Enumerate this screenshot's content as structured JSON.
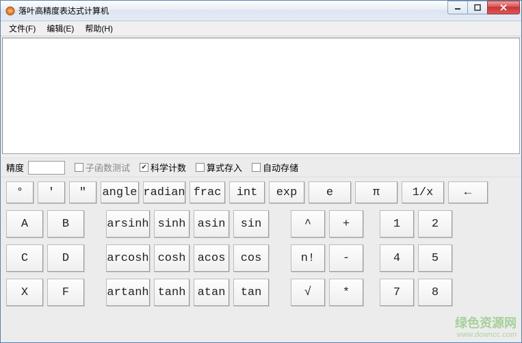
{
  "window": {
    "title": "落叶高精度表达式计算机"
  },
  "menu": {
    "file": "文件(F)",
    "edit": "编辑(E)",
    "help": "帮助(H)"
  },
  "textarea": {
    "value": ""
  },
  "options": {
    "precision_label": "精度",
    "precision_value": "",
    "subfn_test": "子函数测试",
    "sci_notation": "科学计数",
    "save_expr": "算式存入",
    "auto_save": "自动存储"
  },
  "row_top": {
    "deg": "°",
    "min": "′",
    "sec": "″",
    "angle": "angle",
    "radian": "radian",
    "frac": "frac",
    "int": "int",
    "exp": "exp",
    "e": "e",
    "pi": "π",
    "inv": "1/x",
    "back": "←"
  },
  "rows": [
    {
      "hex1": "A",
      "hex2": "B",
      "ar": "arsinh",
      "hyp": "sinh",
      "ainv": "asin",
      "trig": "sin",
      "op1": "^",
      "op2": "+",
      "n1": "1",
      "n2": "2"
    },
    {
      "hex1": "C",
      "hex2": "D",
      "ar": "arcosh",
      "hyp": "cosh",
      "ainv": "acos",
      "trig": "cos",
      "op1": "n!",
      "op2": "-",
      "n1": "4",
      "n2": "5"
    },
    {
      "hex1": "X",
      "hex2": "F",
      "ar": "artanh",
      "hyp": "tanh",
      "ainv": "atan",
      "trig": "tan",
      "op1": "√",
      "op2": "*",
      "n1": "7",
      "n2": "8"
    }
  ],
  "watermark": {
    "main": "绿色资源网",
    "sub": "www.downcc.com"
  }
}
